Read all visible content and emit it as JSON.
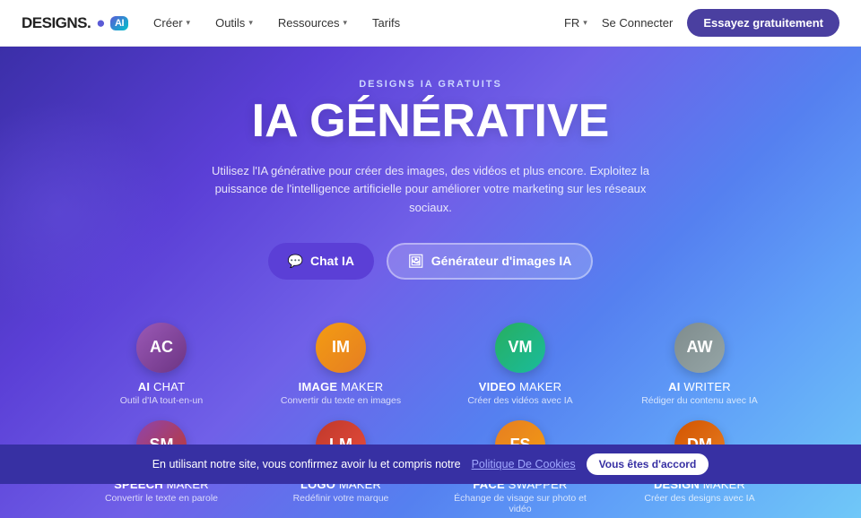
{
  "navbar": {
    "logo_text": "DESIGNS.",
    "logo_ai": "AI",
    "nav_items": [
      {
        "label": "Créer",
        "has_chevron": true
      },
      {
        "label": "Outils",
        "has_chevron": true
      },
      {
        "label": "Ressources",
        "has_chevron": true
      },
      {
        "label": "Tarifs",
        "has_chevron": false
      }
    ],
    "lang": "FR",
    "connect_label": "Se Connecter",
    "try_label": "Essayez gratuitement"
  },
  "hero": {
    "subtitle": "DESIGNS IA GRATUITS",
    "title": "IA GÉNÉRATIVE",
    "description": "Utilisez l'IA générative pour créer des images, des vidéos et plus encore. Exploitez la puissance de l'intelligence artificielle pour améliorer votre marketing sur les réseaux sociaux.",
    "btn_chat": "Chat IA",
    "btn_generator": "Générateur d'images IA"
  },
  "tools": [
    {
      "initials": "AC",
      "name_bold": "AI",
      "name_light": "CHAT",
      "desc": "Outil d'IA tout-en-un",
      "gradient_from": "#9b59b6",
      "gradient_to": "#6c3483"
    },
    {
      "initials": "IM",
      "name_bold": "IMAGE",
      "name_light": "MAKER",
      "desc": "Convertir du texte en images",
      "gradient_from": "#f39c12",
      "gradient_to": "#e67e22"
    },
    {
      "initials": "VM",
      "name_bold": "VIDEO",
      "name_light": "MAKER",
      "desc": "Créer des vidéos avec IA",
      "gradient_from": "#27ae60",
      "gradient_to": "#1abc9c"
    },
    {
      "initials": "AW",
      "name_bold": "AI",
      "name_light": "WRITER",
      "desc": "Rédiger du contenu avec IA",
      "gradient_from": "#7f8c8d",
      "gradient_to": "#95a5a6"
    },
    {
      "initials": "SM",
      "name_bold": "SPEECH",
      "name_light": "MAKER",
      "desc": "Convertir le texte en parole",
      "gradient_from": "#8e44ad",
      "gradient_to": "#c0392b"
    },
    {
      "initials": "LM",
      "name_bold": "LOGO",
      "name_light": "MAKER",
      "desc": "Redéfinir votre marque",
      "gradient_from": "#c0392b",
      "gradient_to": "#e74c3c"
    },
    {
      "initials": "FS",
      "name_bold": "FACE",
      "name_light": "SWAPPER",
      "desc": "Échange de visage sur photo et vidéo",
      "gradient_from": "#e67e22",
      "gradient_to": "#f39c12"
    },
    {
      "initials": "DM",
      "name_bold": "DESIGN",
      "name_light": "MAKER",
      "desc": "Créer des designs avec IA",
      "gradient_from": "#d35400",
      "gradient_to": "#e67e22"
    }
  ],
  "cookie": {
    "text": "En utilisant notre site, vous confirmez avoir lu et compris notre",
    "link_text": "Politique De Cookies",
    "accept_label": "Vous êtes d'accord"
  }
}
